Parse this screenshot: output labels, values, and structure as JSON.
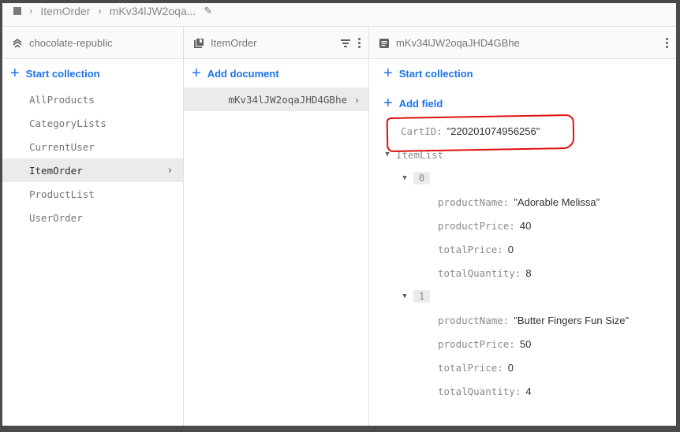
{
  "breadcrumb": {
    "items": [
      "ItemOrder",
      "mKv34lJW2oqa..."
    ]
  },
  "columns": {
    "root": {
      "title": "chocolate-republic",
      "icon": "firestore-icon",
      "action_label": "Start collection",
      "collections": [
        {
          "name": "AllProducts",
          "selected": false
        },
        {
          "name": "CategoryLists",
          "selected": false
        },
        {
          "name": "CurrentUser",
          "selected": false
        },
        {
          "name": "ItemOrder",
          "selected": true
        },
        {
          "name": "ProductList",
          "selected": false
        },
        {
          "name": "UserOrder",
          "selected": false
        }
      ]
    },
    "collection": {
      "title": "ItemOrder",
      "icon": "collection-icon",
      "action_label": "Add document",
      "documents": [
        {
          "id": "mKv34lJW2oqaJHD4GBhe",
          "selected": true
        }
      ]
    },
    "document": {
      "title": "mKv34lJW2oqaJHD4GBhe",
      "icon": "document-icon",
      "start_collection_label": "Start collection",
      "add_field_label": "Add field",
      "fields": {
        "cart_id_key": "CartID:",
        "cart_id_value": "\"220201074956256\"",
        "item_list_key": "ItemList",
        "items": [
          {
            "index": "0",
            "productName_key": "productName:",
            "productName": "\"Adorable Melissa\"",
            "productPrice_key": "productPrice:",
            "productPrice": "40",
            "totalPrice_key": "totalPrice:",
            "totalPrice": "0",
            "totalQuantity_key": "totalQuantity:",
            "totalQuantity": "8"
          },
          {
            "index": "1",
            "productName_key": "productName:",
            "productName": "\"Butter Fingers Fun Size\"",
            "productPrice_key": "productPrice:",
            "productPrice": "50",
            "totalPrice_key": "totalPrice:",
            "totalPrice": "0",
            "totalQuantity_key": "totalQuantity:",
            "totalQuantity": "4"
          }
        ]
      }
    }
  },
  "icons": {
    "chevron": "›",
    "plus": "+",
    "triangle_down": "▼"
  },
  "annotation_color": "#e01010"
}
